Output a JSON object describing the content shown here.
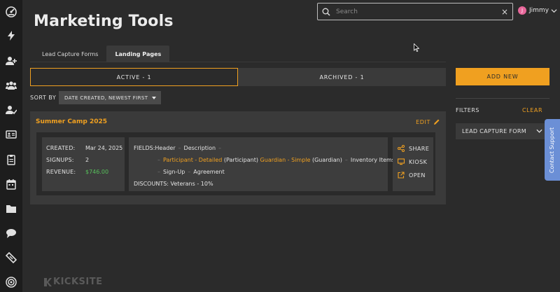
{
  "nav": {
    "icons": [
      "dashboard-icon",
      "bolt-icon",
      "add-user-icon",
      "users-icon",
      "user-check-icon",
      "id-card-icon",
      "clipboard-icon",
      "calendar-icon",
      "folder-icon",
      "chat-icon",
      "ticket-icon",
      "target-icon"
    ]
  },
  "header": {
    "title": "Marketing Tools",
    "search_placeholder": "Search",
    "clear_label": "×",
    "user_name": "Jimmy",
    "user_initial": "J"
  },
  "tabs": [
    {
      "label": "Lead Capture Forms",
      "active": false
    },
    {
      "label": "Landing Pages",
      "active": true
    }
  ],
  "segments": {
    "active_label": "ACTIVE - 1",
    "archived_label": "ARCHIVED - 1"
  },
  "sort": {
    "label": "SORT BY",
    "selected": "DATE CREATED, NEWEST FIRST"
  },
  "card": {
    "title": "Summer Camp 2025",
    "edit_label": "EDIT",
    "stats": [
      {
        "label": "CREATED:",
        "value": "Mar 24, 2025"
      },
      {
        "label": "SIGNUPS:",
        "value": "2"
      },
      {
        "label": "REVENUE:",
        "value": "$746.00"
      }
    ],
    "fields_label": "FIELDS:",
    "fields": {
      "header": "Header",
      "description": "Description",
      "participant_form": "Participant - Detailed",
      "participant_role": "(Participant)",
      "guardian_form": "Guardian - Simple",
      "guardian_role": "(Guardian)",
      "inventory": "Inventory Items",
      "signup": "Sign-Up",
      "agreement": "Agreement"
    },
    "discounts_label": "DISCOUNTS:",
    "discounts_value": "Veterans - 10%",
    "actions": {
      "share": "SHARE",
      "kiosk": "KIOSK",
      "open": "OPEN"
    }
  },
  "sidebar": {
    "add_new": "ADD NEW",
    "filters_label": "FILTERS",
    "clear_label": "CLEAR",
    "filter_selected": "LEAD CAPTURE FORM"
  },
  "support": {
    "label": "Contact Support"
  },
  "logo": {
    "text": "KICKSITE"
  },
  "colors": {
    "accent": "#f0a020",
    "revenue": "#56c05a",
    "support": "#6b8fd6",
    "avatar": "#e7679a"
  }
}
